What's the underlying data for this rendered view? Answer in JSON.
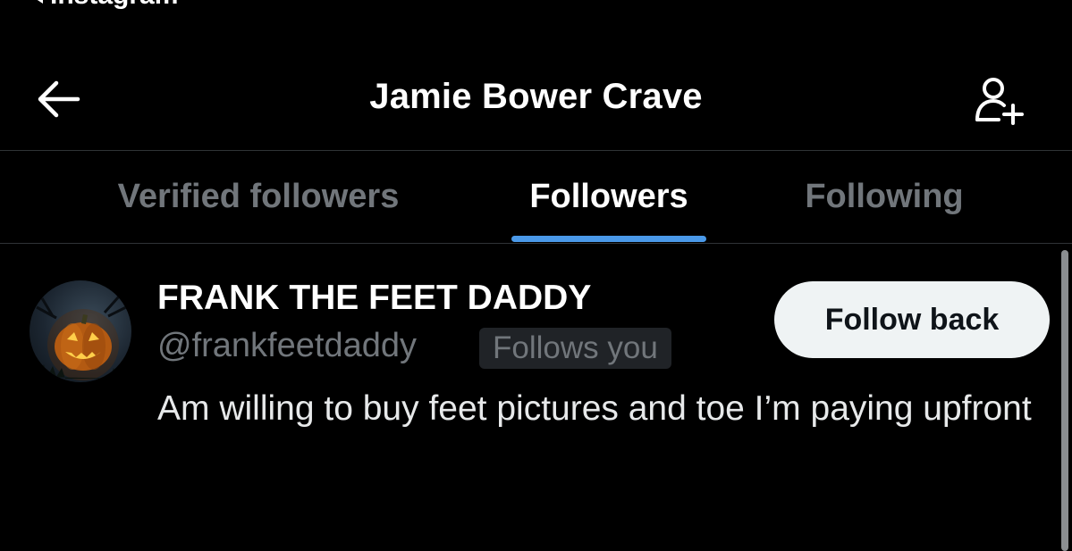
{
  "status_bar": {
    "back_app": "Instagram"
  },
  "header": {
    "title": "Jamie Bower Crave",
    "back_icon": "arrow-left-icon",
    "add_user_icon": "person-plus-icon"
  },
  "tabs": [
    {
      "label": "Verified followers",
      "active": false
    },
    {
      "label": "Followers",
      "active": true
    },
    {
      "label": "Following",
      "active": false
    }
  ],
  "followers": [
    {
      "display_name": "FRANK THE FEET DADDY",
      "handle": "@frankfeetdaddy",
      "badge": "Follows you",
      "bio": "Am willing to buy feet pictures and toe I’m paying upfront",
      "button_label": "Follow back",
      "avatar_icon": "jack-o-lantern-avatar"
    }
  ],
  "colors": {
    "background": "#000000",
    "accent": "#4a99e9",
    "muted_text": "#71767b",
    "button_bg": "#eff3f4"
  }
}
